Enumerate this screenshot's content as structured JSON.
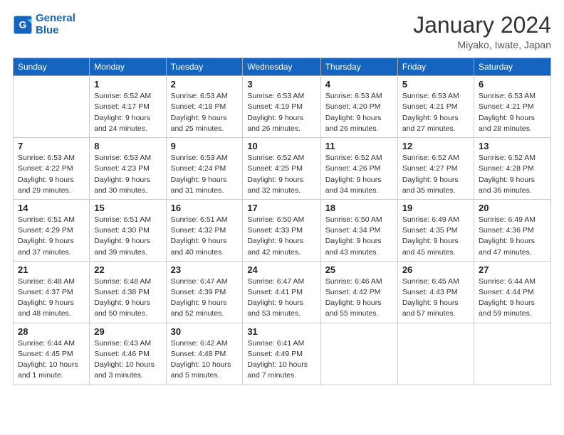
{
  "logo": {
    "line1": "General",
    "line2": "Blue"
  },
  "title": "January 2024",
  "location": "Miyako, Iwate, Japan",
  "weekdays": [
    "Sunday",
    "Monday",
    "Tuesday",
    "Wednesday",
    "Thursday",
    "Friday",
    "Saturday"
  ],
  "weeks": [
    [
      {
        "day": "",
        "sunrise": "",
        "sunset": "",
        "daylight": ""
      },
      {
        "day": "1",
        "sunrise": "Sunrise: 6:52 AM",
        "sunset": "Sunset: 4:17 PM",
        "daylight": "Daylight: 9 hours and 24 minutes."
      },
      {
        "day": "2",
        "sunrise": "Sunrise: 6:53 AM",
        "sunset": "Sunset: 4:18 PM",
        "daylight": "Daylight: 9 hours and 25 minutes."
      },
      {
        "day": "3",
        "sunrise": "Sunrise: 6:53 AM",
        "sunset": "Sunset: 4:19 PM",
        "daylight": "Daylight: 9 hours and 26 minutes."
      },
      {
        "day": "4",
        "sunrise": "Sunrise: 6:53 AM",
        "sunset": "Sunset: 4:20 PM",
        "daylight": "Daylight: 9 hours and 26 minutes."
      },
      {
        "day": "5",
        "sunrise": "Sunrise: 6:53 AM",
        "sunset": "Sunset: 4:21 PM",
        "daylight": "Daylight: 9 hours and 27 minutes."
      },
      {
        "day": "6",
        "sunrise": "Sunrise: 6:53 AM",
        "sunset": "Sunset: 4:21 PM",
        "daylight": "Daylight: 9 hours and 28 minutes."
      }
    ],
    [
      {
        "day": "7",
        "sunrise": "Sunrise: 6:53 AM",
        "sunset": "Sunset: 4:22 PM",
        "daylight": "Daylight: 9 hours and 29 minutes."
      },
      {
        "day": "8",
        "sunrise": "Sunrise: 6:53 AM",
        "sunset": "Sunset: 4:23 PM",
        "daylight": "Daylight: 9 hours and 30 minutes."
      },
      {
        "day": "9",
        "sunrise": "Sunrise: 6:53 AM",
        "sunset": "Sunset: 4:24 PM",
        "daylight": "Daylight: 9 hours and 31 minutes."
      },
      {
        "day": "10",
        "sunrise": "Sunrise: 6:52 AM",
        "sunset": "Sunset: 4:25 PM",
        "daylight": "Daylight: 9 hours and 32 minutes."
      },
      {
        "day": "11",
        "sunrise": "Sunrise: 6:52 AM",
        "sunset": "Sunset: 4:26 PM",
        "daylight": "Daylight: 9 hours and 34 minutes."
      },
      {
        "day": "12",
        "sunrise": "Sunrise: 6:52 AM",
        "sunset": "Sunset: 4:27 PM",
        "daylight": "Daylight: 9 hours and 35 minutes."
      },
      {
        "day": "13",
        "sunrise": "Sunrise: 6:52 AM",
        "sunset": "Sunset: 4:28 PM",
        "daylight": "Daylight: 9 hours and 36 minutes."
      }
    ],
    [
      {
        "day": "14",
        "sunrise": "Sunrise: 6:51 AM",
        "sunset": "Sunset: 4:29 PM",
        "daylight": "Daylight: 9 hours and 37 minutes."
      },
      {
        "day": "15",
        "sunrise": "Sunrise: 6:51 AM",
        "sunset": "Sunset: 4:30 PM",
        "daylight": "Daylight: 9 hours and 39 minutes."
      },
      {
        "day": "16",
        "sunrise": "Sunrise: 6:51 AM",
        "sunset": "Sunset: 4:32 PM",
        "daylight": "Daylight: 9 hours and 40 minutes."
      },
      {
        "day": "17",
        "sunrise": "Sunrise: 6:50 AM",
        "sunset": "Sunset: 4:33 PM",
        "daylight": "Daylight: 9 hours and 42 minutes."
      },
      {
        "day": "18",
        "sunrise": "Sunrise: 6:50 AM",
        "sunset": "Sunset: 4:34 PM",
        "daylight": "Daylight: 9 hours and 43 minutes."
      },
      {
        "day": "19",
        "sunrise": "Sunrise: 6:49 AM",
        "sunset": "Sunset: 4:35 PM",
        "daylight": "Daylight: 9 hours and 45 minutes."
      },
      {
        "day": "20",
        "sunrise": "Sunrise: 6:49 AM",
        "sunset": "Sunset: 4:36 PM",
        "daylight": "Daylight: 9 hours and 47 minutes."
      }
    ],
    [
      {
        "day": "21",
        "sunrise": "Sunrise: 6:48 AM",
        "sunset": "Sunset: 4:37 PM",
        "daylight": "Daylight: 9 hours and 48 minutes."
      },
      {
        "day": "22",
        "sunrise": "Sunrise: 6:48 AM",
        "sunset": "Sunset: 4:38 PM",
        "daylight": "Daylight: 9 hours and 50 minutes."
      },
      {
        "day": "23",
        "sunrise": "Sunrise: 6:47 AM",
        "sunset": "Sunset: 4:39 PM",
        "daylight": "Daylight: 9 hours and 52 minutes."
      },
      {
        "day": "24",
        "sunrise": "Sunrise: 6:47 AM",
        "sunset": "Sunset: 4:41 PM",
        "daylight": "Daylight: 9 hours and 53 minutes."
      },
      {
        "day": "25",
        "sunrise": "Sunrise: 6:46 AM",
        "sunset": "Sunset: 4:42 PM",
        "daylight": "Daylight: 9 hours and 55 minutes."
      },
      {
        "day": "26",
        "sunrise": "Sunrise: 6:45 AM",
        "sunset": "Sunset: 4:43 PM",
        "daylight": "Daylight: 9 hours and 57 minutes."
      },
      {
        "day": "27",
        "sunrise": "Sunrise: 6:44 AM",
        "sunset": "Sunset: 4:44 PM",
        "daylight": "Daylight: 9 hours and 59 minutes."
      }
    ],
    [
      {
        "day": "28",
        "sunrise": "Sunrise: 6:44 AM",
        "sunset": "Sunset: 4:45 PM",
        "daylight": "Daylight: 10 hours and 1 minute."
      },
      {
        "day": "29",
        "sunrise": "Sunrise: 6:43 AM",
        "sunset": "Sunset: 4:46 PM",
        "daylight": "Daylight: 10 hours and 3 minutes."
      },
      {
        "day": "30",
        "sunrise": "Sunrise: 6:42 AM",
        "sunset": "Sunset: 4:48 PM",
        "daylight": "Daylight: 10 hours and 5 minutes."
      },
      {
        "day": "31",
        "sunrise": "Sunrise: 6:41 AM",
        "sunset": "Sunset: 4:49 PM",
        "daylight": "Daylight: 10 hours and 7 minutes."
      },
      {
        "day": "",
        "sunrise": "",
        "sunset": "",
        "daylight": ""
      },
      {
        "day": "",
        "sunrise": "",
        "sunset": "",
        "daylight": ""
      },
      {
        "day": "",
        "sunrise": "",
        "sunset": "",
        "daylight": ""
      }
    ]
  ]
}
